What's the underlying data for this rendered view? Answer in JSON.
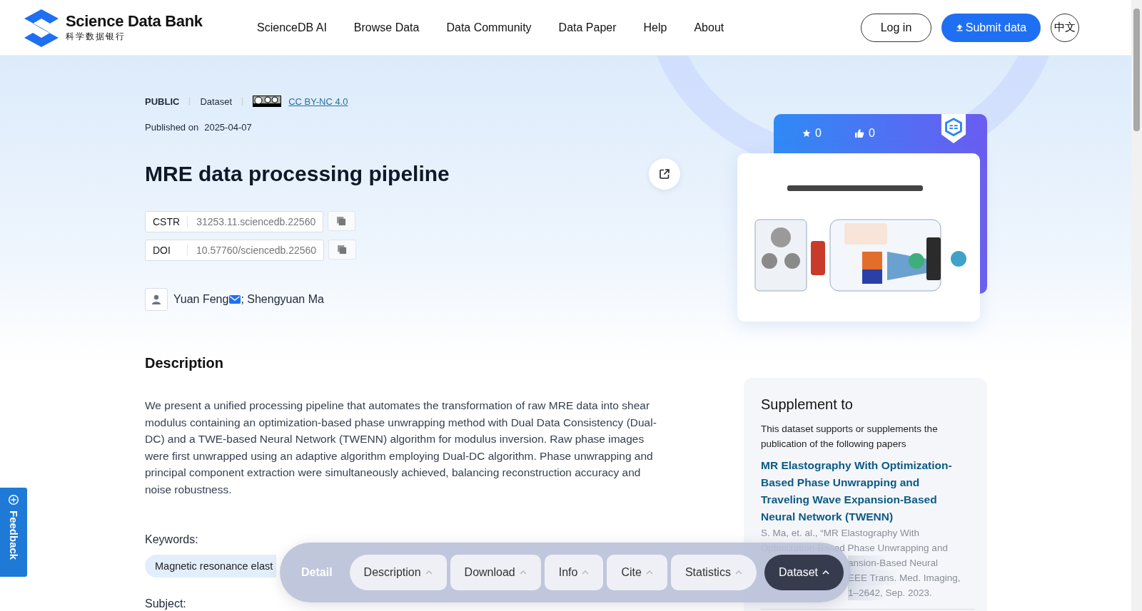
{
  "header": {
    "logo": {
      "name": "Science Data Bank",
      "subtitle": "科学数据银行"
    },
    "nav": [
      {
        "label": "ScienceDB AI"
      },
      {
        "label": "Browse Data"
      },
      {
        "label": "Data Community"
      },
      {
        "label": "Data Paper"
      },
      {
        "label": "Help"
      },
      {
        "label": "About"
      }
    ],
    "login": "Log in",
    "submit": "Submit data",
    "language": "中文"
  },
  "meta": {
    "access": "PUBLIC",
    "type": "Dataset",
    "license": "CC BY-NC 4.0",
    "published_label": "Published on",
    "published_date": "2025-04-07"
  },
  "title": "MRE data processing pipeline",
  "identifiers": [
    {
      "label": "CSTR",
      "value": "31253.11.sciencedb.22560"
    },
    {
      "label": "DOI",
      "value": "10.57760/sciencedb.22560"
    }
  ],
  "authors": [
    {
      "text": "Yuan Feng",
      "email": true
    },
    {
      "text": "; Shengyuan Ma",
      "email": false
    }
  ],
  "stats": {
    "favorites": "0",
    "likes": "0"
  },
  "description": {
    "heading": "Description",
    "text": "We present a unified processing pipeline that automates the transformation of raw MRE data into shear modulus containing an optimization-based phase unwrapping method with Dual Data Consistency (Dual-DC) and a TWE-based Neural Network (TWENN) algorithm for modulus inversion. Raw phase images were first unwrapped using an adaptive algorithm employing Dual-DC algorithm. Phase unwrapping and principal component extraction were simultaneously achieved, balancing reconstruction accuracy and noise robustness."
  },
  "keywords": {
    "label": "Keywords:",
    "items": [
      "Magnetic resonance elast"
    ]
  },
  "subject": {
    "label": "Subject:"
  },
  "supplement": {
    "heading": "Supplement to",
    "intro": "This dataset supports or supplements the publication of the following papers",
    "paper_title": "MR Elastography With Optimization-Based Phase Unwrapping and Traveling Wave Expansion-Based Neural Network (TWENN)",
    "citation_lines": [
      {
        "text": "S. Ma, et. al., “MR Elastography With",
        "cut": false
      },
      {
        "text": "Optimization-Based Phase Unwrapping and",
        "cut": false
      },
      {
        "text": "ansion-Based Neural",
        "cut": true
      },
      {
        "text": "EEE Trans. Med. Imaging,",
        "cut": true
      },
      {
        "text": "1–2642, Sep. 2023.",
        "cut": true
      }
    ]
  },
  "detail_nav": {
    "label": "Detail",
    "tabs": [
      {
        "label": "Description",
        "selected": false
      },
      {
        "label": "Download",
        "selected": false
      },
      {
        "label": "Info",
        "selected": false
      },
      {
        "label": "Cite",
        "selected": false
      },
      {
        "label": "Statistics",
        "selected": false
      },
      {
        "label": "Dataset",
        "selected": true
      }
    ]
  },
  "feedback": "Feedback"
}
